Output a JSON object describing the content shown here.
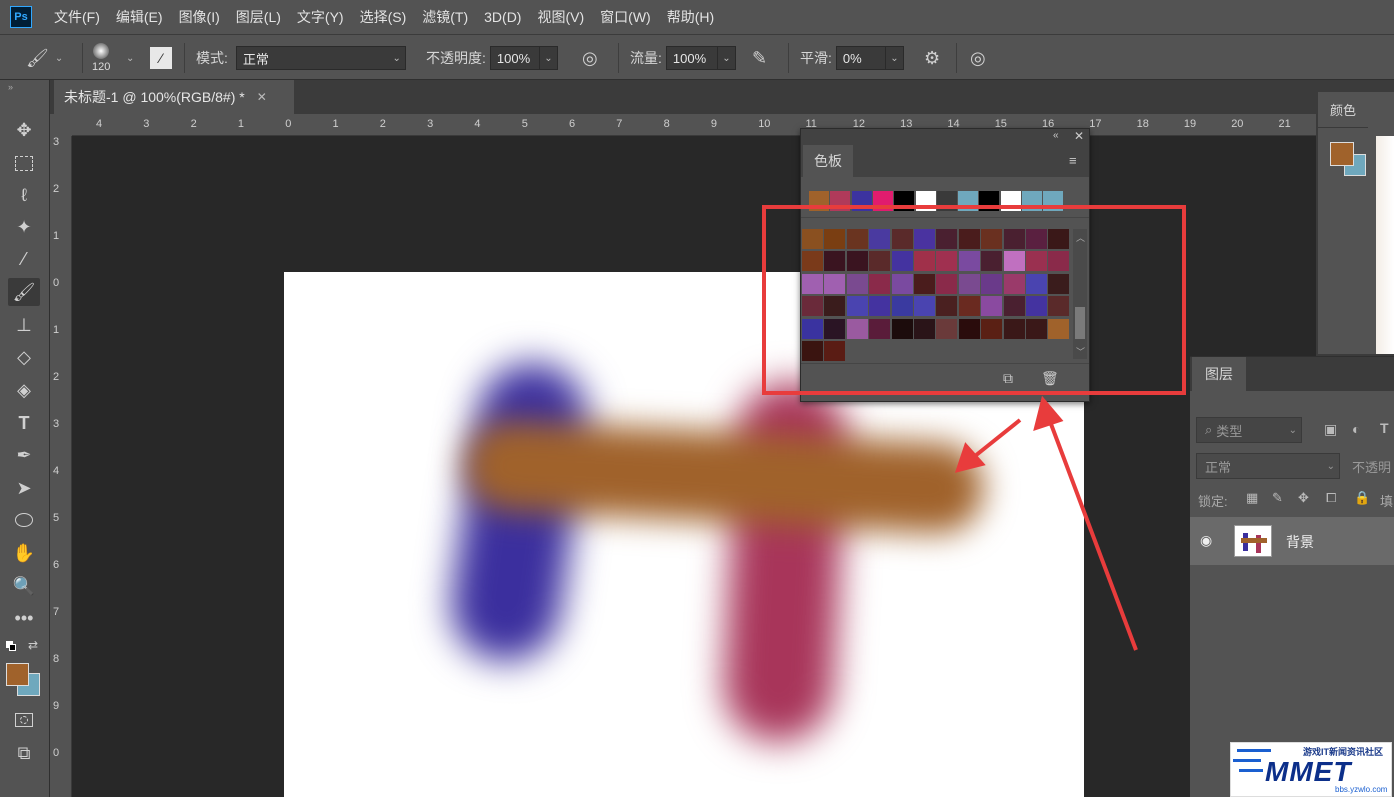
{
  "menubar": {
    "logo": "Ps",
    "items": [
      "文件(F)",
      "编辑(E)",
      "图像(I)",
      "图层(L)",
      "文字(Y)",
      "选择(S)",
      "滤镜(T)",
      "3D(D)",
      "视图(V)",
      "窗口(W)",
      "帮助(H)"
    ]
  },
  "options": {
    "brush_size": "120",
    "mode_label": "模式:",
    "mode_value": "正常",
    "opacity_label": "不透明度:",
    "opacity_value": "100%",
    "flow_label": "流量:",
    "flow_value": "100%",
    "smooth_label": "平滑:",
    "smooth_value": "0%"
  },
  "document": {
    "tab_title": "未标题-1 @ 100%(RGB/8#) *"
  },
  "rulers": {
    "top_ticks": [
      "4",
      "3",
      "2",
      "1",
      "0",
      "1",
      "2",
      "3",
      "4",
      "5",
      "6",
      "7",
      "8",
      "9",
      "10",
      "11",
      "12",
      "13",
      "14",
      "15",
      "16",
      "17",
      "18",
      "19",
      "20",
      "21"
    ],
    "left_ticks": [
      "3",
      "2",
      "1",
      "0",
      "1",
      "2",
      "3",
      "4",
      "5",
      "6",
      "7",
      "8",
      "9",
      "0"
    ]
  },
  "color_panel": {
    "title": "颜色",
    "foreground": "#a0622b",
    "background": "#6fa8bd"
  },
  "swatches_panel": {
    "title": "色板",
    "recent": [
      "#a0622b",
      "#b03a5a",
      "#3c33a0",
      "#e01c6e",
      "#000000",
      "#ffffff",
      "#3a3a3a",
      "#6fa8bd",
      "#000000",
      "#ffffff",
      "#6fa8bd",
      "#6fa8bd"
    ],
    "grid": [
      [
        "#8a5020",
        "#7a3e12",
        "#6a3420",
        "#4a3aa0",
        "#5a2a2a",
        "#4a33a0",
        "#4a2030",
        "#4a1c1c",
        "#6a3020",
        "#4a2030",
        "#5a2040",
        "#3a1818"
      ],
      [
        "#7a3a1a",
        "#3a1420",
        "#3a1420",
        "#5a2a2a",
        "#4433a0",
        "#a0304a",
        "#a03050",
        "#7a4aa0",
        "#4a2030",
        "#c070c0",
        "#9a3050",
        "#8a2a4a"
      ],
      [
        "#a060b0",
        "#a060b0",
        "#7a4a90",
        "#8a2a4a",
        "#7a4aa0",
        "#4a1c1c",
        "#8a2a4a",
        "#7a4a90",
        "#6a3a8a",
        "#9a3a6a",
        "#4a44b0",
        "#3a1c1c"
      ],
      [
        "#6a2a3a",
        "#3a1c1c",
        "#4a44b0",
        "#4433a0",
        "#3a3aa0",
        "#4a44b0",
        "#4a2020",
        "#6a2a20",
        "#8a4aa0",
        "#4a2030",
        "#4433a0",
        "#5a2a2a"
      ],
      [
        "#3a33a0",
        "#2a1424",
        "#9a5aa0",
        "#5a1c3a",
        "#1c0c0c",
        "#2a1418",
        "#6a3a3a",
        "#2a0c0c",
        "#5a2014",
        "#3a1818",
        "#3a1818",
        "#a0622b"
      ],
      [
        "#3a1410",
        "#5a1c14"
      ]
    ]
  },
  "layers_panel": {
    "title": "图层",
    "filter_label": "类型",
    "blend_mode": "正常",
    "opacity_label": "不透明",
    "lock_label": "锁定:",
    "fill_label": "填",
    "layer_name": "背景"
  },
  "watermark": {
    "brand": "MMET",
    "tagline": "游戏IT新闻资讯社区",
    "url": "bbs.yzwlo.com"
  }
}
